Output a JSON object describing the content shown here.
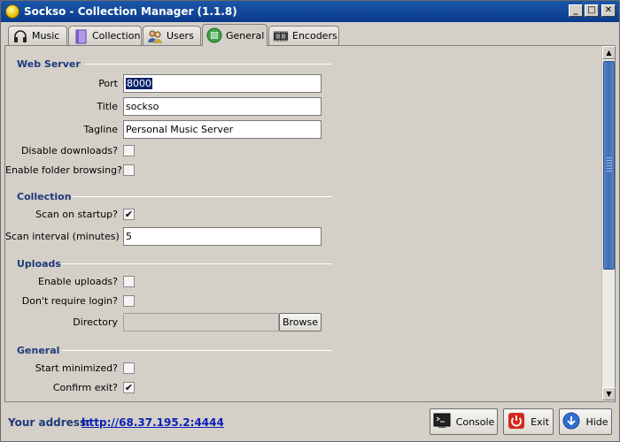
{
  "window": {
    "title": "Sockso - Collection Manager (1.1.8)",
    "min": "_",
    "max": "□",
    "close": "✕"
  },
  "tabs": [
    {
      "label": "Music",
      "icon": "headphones-icon"
    },
    {
      "label": "Collection",
      "icon": "collection-book-icon"
    },
    {
      "label": "Users",
      "icon": "users-icon"
    },
    {
      "label": "General",
      "icon": "general-settings-icon",
      "active": true
    },
    {
      "label": "Encoders",
      "icon": "film-strip-icon"
    }
  ],
  "sections": {
    "web_server": {
      "title": "Web Server",
      "port_label": "Port",
      "port_value": "8000",
      "title_label": "Title",
      "title_value": "sockso",
      "tagline_label": "Tagline",
      "tagline_value": "Personal Music Server",
      "disable_downloads_label": "Disable downloads?",
      "disable_downloads": false,
      "folder_browsing_label": "Enable folder browsing?",
      "folder_browsing": false
    },
    "collection": {
      "title": "Collection",
      "scan_startup_label": "Scan on startup?",
      "scan_startup": true,
      "scan_interval_label": "Scan interval (minutes)",
      "scan_interval_value": "5"
    },
    "uploads": {
      "title": "Uploads",
      "enable_uploads_label": "Enable uploads?",
      "enable_uploads": false,
      "no_login_label": "Don't require login?",
      "no_login": false,
      "directory_label": "Directory",
      "directory_value": "",
      "browse_label": "Browse"
    },
    "general": {
      "title": "General",
      "start_minimized_label": "Start minimized?",
      "start_minimized": false,
      "confirm_exit_label": "Confirm exit?",
      "confirm_exit": true
    }
  },
  "status": {
    "address_label": "Your address:",
    "address_url": "http://68.37.195.2:4444",
    "console_label": "Console",
    "exit_label": "Exit",
    "hide_label": "Hide"
  },
  "colors": {
    "titlebar": "#0a3a8c",
    "section_title": "#1f3a7a",
    "link": "#0b1fb8",
    "selection": "#0a246a",
    "exit_icon": "#d42a1c",
    "hide_icon": "#2f6fd0"
  }
}
